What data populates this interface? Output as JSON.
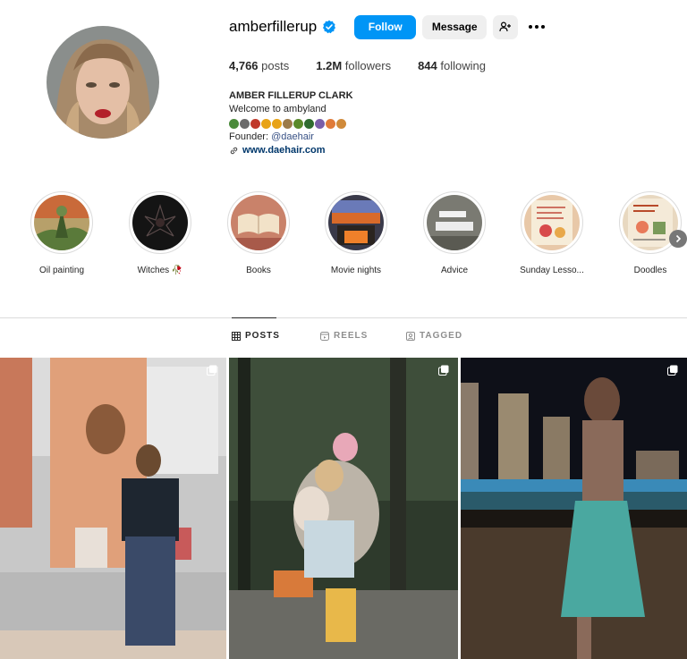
{
  "profile": {
    "username": "amberfillerup",
    "verified": true,
    "follow_label": "Follow",
    "message_label": "Message"
  },
  "stats": {
    "posts_count": "4,766",
    "posts_label": "posts",
    "followers_count": "1.2M",
    "followers_label": "followers",
    "following_count": "844",
    "following_label": "following"
  },
  "bio": {
    "full_name": "AMBER FILLERUP CLARK",
    "line1": "Welcome to ambyland",
    "emojis": [
      "#4a8a3a",
      "#6b6b6b",
      "#c0392b",
      "#e8a317",
      "#e8a317",
      "#9c7b4a",
      "#5a8a2a",
      "#2f6b2f",
      "#7a5ea8",
      "#e07b39",
      "#d08a3a"
    ],
    "founder_prefix": "Founder: ",
    "founder_mention": "@daehair",
    "website": "www.daehair.com"
  },
  "highlights": [
    {
      "label": "Oil painting"
    },
    {
      "label": "Witches 🥀"
    },
    {
      "label": "Books"
    },
    {
      "label": "Movie nights"
    },
    {
      "label": "Advice"
    },
    {
      "label": "Sunday Lesso..."
    },
    {
      "label": "Doodles"
    }
  ],
  "tabs": {
    "posts": "POSTS",
    "reels": "REELS",
    "tagged": "TAGGED"
  },
  "colors": {
    "accent": "#0095f6",
    "verified_badge": "#0095f6",
    "link": "#00376b"
  }
}
